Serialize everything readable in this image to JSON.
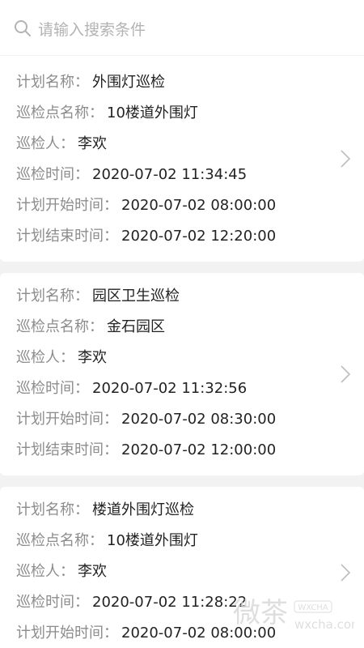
{
  "search": {
    "placeholder": "请输入搜索条件"
  },
  "records": [
    {
      "rows": [
        {
          "label": "计划名称：",
          "value": "外围灯巡检"
        },
        {
          "label": "巡检点名称：",
          "value": "10楼道外围灯"
        },
        {
          "label": "巡检人：",
          "value": "李欢"
        },
        {
          "label": "巡检时间：",
          "value": "2020-07-02 11:34:45"
        },
        {
          "label": "计划开始时间：",
          "value": "2020-07-02 08:00:00"
        },
        {
          "label": "计划结束时间：",
          "value": "2020-07-02 12:20:00"
        }
      ]
    },
    {
      "rows": [
        {
          "label": "计划名称：",
          "value": "园区卫生巡检"
        },
        {
          "label": "巡检点名称：",
          "value": "金石园区"
        },
        {
          "label": "巡检人：",
          "value": "李欢"
        },
        {
          "label": "巡检时间：",
          "value": "2020-07-02 11:32:56"
        },
        {
          "label": "计划开始时间：",
          "value": "2020-07-02 08:30:00"
        },
        {
          "label": "计划结束时间：",
          "value": "2020-07-02 12:00:00"
        }
      ]
    },
    {
      "rows": [
        {
          "label": "计划名称：",
          "value": "楼道外围灯巡检"
        },
        {
          "label": "巡检点名称：",
          "value": "10楼道外围灯"
        },
        {
          "label": "巡检人：",
          "value": "李欢"
        },
        {
          "label": "巡检时间：",
          "value": "2020-07-02 11:28:22"
        },
        {
          "label": "计划开始时间：",
          "value": "2020-07-02 08:00:00"
        }
      ]
    }
  ],
  "watermark": {
    "text": "微茶",
    "sub_text": "WXCHA",
    "domain": "wxcha.com"
  },
  "icons": {
    "search": "search-icon",
    "chevron": "chevron-right-icon"
  },
  "colors": {
    "background": "#f2f2f2",
    "card": "#ffffff",
    "label": "#8c8c8c",
    "value": "#222222",
    "placeholder": "#b3b3b3"
  }
}
